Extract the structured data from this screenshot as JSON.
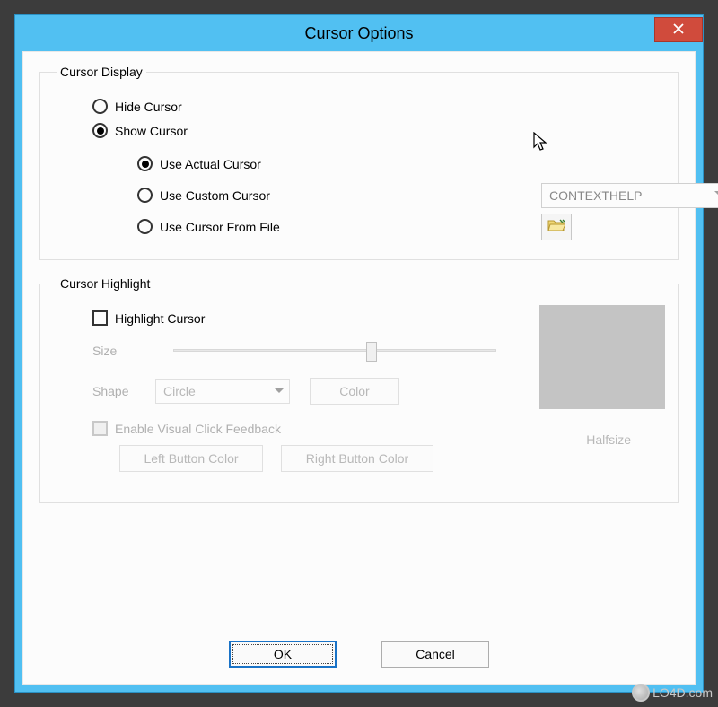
{
  "window": {
    "title": "Cursor Options"
  },
  "cursor_display": {
    "legend": "Cursor Display",
    "hide_label": "Hide Cursor",
    "show_label": "Show Cursor",
    "use_actual_label": "Use Actual Cursor",
    "use_custom_label": "Use Custom Cursor",
    "use_file_label": "Use Cursor From File",
    "custom_dropdown_value": "CONTEXTHELP"
  },
  "cursor_highlight": {
    "legend": "Cursor Highlight",
    "highlight_label": "Highlight Cursor",
    "size_label": "Size",
    "shape_label": "Shape",
    "shape_value": "Circle",
    "color_btn": "Color",
    "enable_vcf_label": "Enable Visual Click Feedback",
    "left_btn": "Left Button Color",
    "right_btn": "Right Button Color",
    "halfsize_label": "Halfsize"
  },
  "buttons": {
    "ok": "OK",
    "cancel": "Cancel"
  },
  "watermark": "LO4D.com"
}
